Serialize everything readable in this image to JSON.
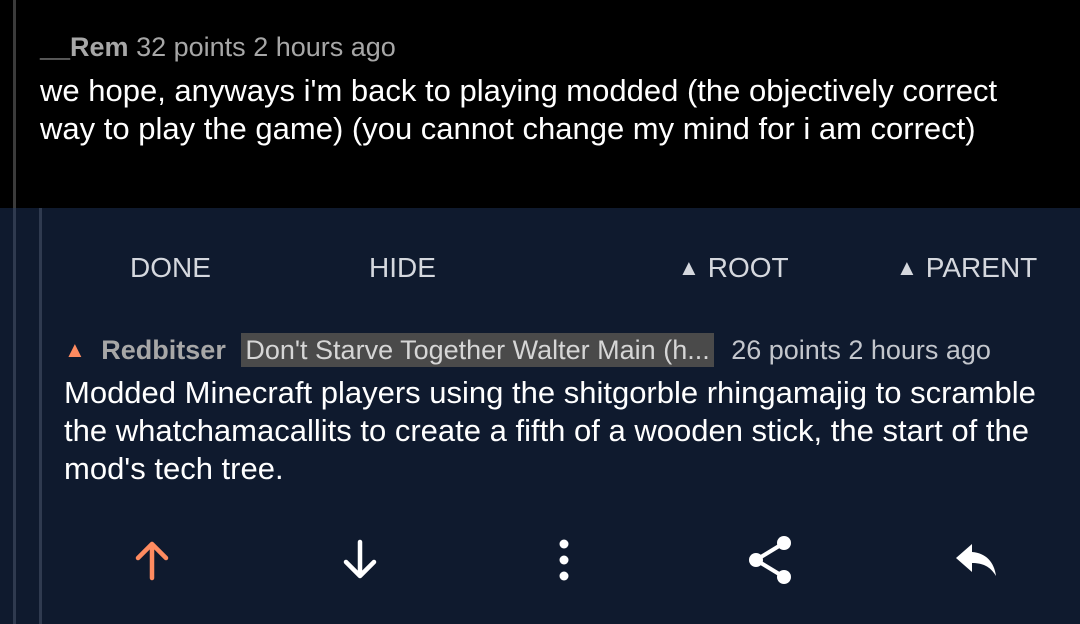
{
  "colors": {
    "background_top": "#000000",
    "background_selected": "#0f1a2e",
    "upvote_accent": "#ff8b60",
    "meta_text": "#a7a7a7",
    "flair_bg": "#4a4a4a"
  },
  "parent_comment": {
    "author": "__Rem",
    "points": "32 points",
    "time": "2 hours ago",
    "body": "we hope, anyways i'm back to playing modded (the objectively correct way to play the game) (you cannot change my mind for i am correct)"
  },
  "action_bar": {
    "done_label": "DONE",
    "hide_label": "HIDE",
    "root_label": "ROOT",
    "parent_label": "PARENT",
    "root_icon": "triangle-up-icon",
    "parent_icon": "triangle-up-icon"
  },
  "selected_comment": {
    "vote_state_icon": "upvoted-triangle-icon",
    "author": "Redbitser",
    "flair": "Don't Starve Together Walter Main (h...",
    "points": "26 points",
    "time": "2 hours ago",
    "body": "Modded Minecraft players using the shitgorble rhingamajig to scramble the whatchamacallits to create a fifth of a wooden stick, the start of the mod's tech tree."
  },
  "icon_bar": {
    "icons": [
      "upvote-arrow-icon",
      "downvote-arrow-icon",
      "more-options-icon",
      "share-icon",
      "reply-icon"
    ]
  }
}
